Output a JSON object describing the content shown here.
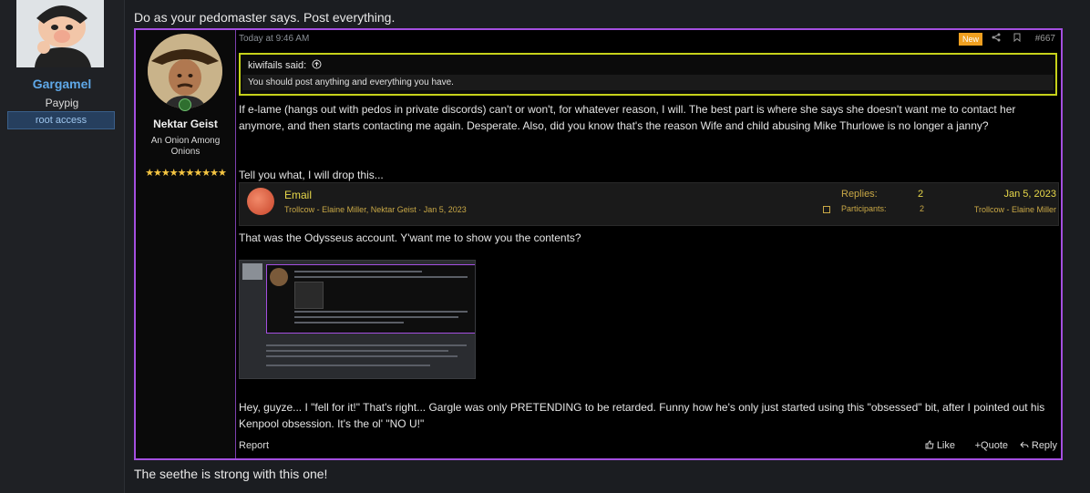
{
  "left": {
    "username": "Gargamel",
    "user_title": "Paypig",
    "banner": "root access"
  },
  "main": {
    "top_text": "Do as your pedomaster says. Post everything.",
    "bottom_text": "The seethe is strong with this one!"
  },
  "quoted_post": {
    "user": {
      "username": "Nektar Geist",
      "title": "An Onion Among Onions",
      "stars": "★★★★★★★★★★"
    },
    "date": "Today at 9:46 AM",
    "new_badge": "New",
    "post_number": "#667",
    "inner_quote": {
      "author": "kiwifails said:",
      "text": "You should post anything and everything you have."
    },
    "paragraph1": "If e-lame (hangs out with pedos in private discords) can't or won't, for whatever reason, I will. The best part is where she says she doesn't want me to contact her anymore, and then starts contacting me again. Desperate. Also, did you know that's the reason Wife and child abusing Mike Thurlowe is no longer a janny?",
    "paragraph2": "Tell you what, I will drop this...",
    "thread": {
      "title": "Email",
      "subtitle": "Trollcow - Elaine Miller, Nektar Geist · Jan 5, 2023",
      "replies_label": "Replies:",
      "replies_value": "2",
      "participants_label": "Participants:",
      "participants_value": "2",
      "last_date": "Jan 5, 2023",
      "last_forum": "Trollcow - Elaine Miller"
    },
    "paragraph3": "That was the Odysseus account. Y'want me to show you the contents?",
    "paragraph4": "Hey, guyze... I \"fell for it!\" That's right... Gargle was only PRETENDING to be retarded. Funny how he's only just started using this \"obsessed\" bit, after I pointed out his Kenpool obsession. It's the ol' \"NO U!\"",
    "footer": {
      "report": "Report",
      "like": "Like",
      "quote": "Quote",
      "reply": "Reply"
    }
  },
  "colors": {
    "accent_purple": "#a44fe0",
    "quote_border": "#c6d11a",
    "username_blue": "#5fa8e8",
    "new_badge": "#f0a020"
  },
  "icons": [
    "share-icon",
    "bookmark-icon",
    "arrow-up-icon",
    "like-icon",
    "plus-icon",
    "reply-icon",
    "online-icon"
  ]
}
